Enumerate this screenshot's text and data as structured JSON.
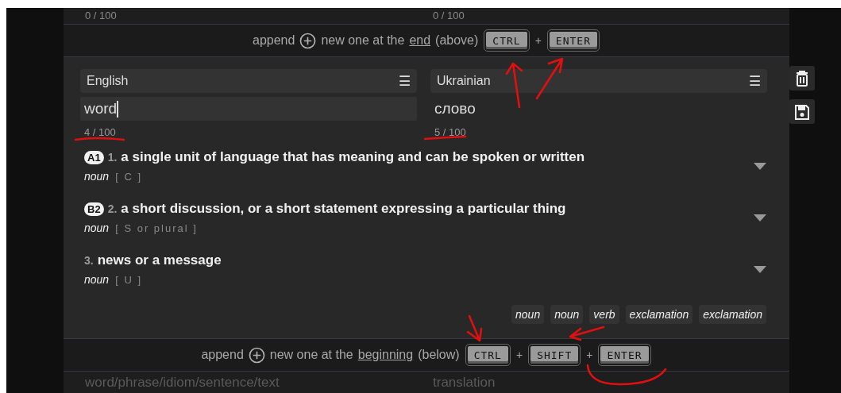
{
  "previous_entry": {
    "counters": [
      "0 / 100",
      "0 / 100"
    ]
  },
  "append_end": {
    "prefix": "append",
    "middle": "new one at the",
    "link": "end",
    "suffix": "(above)",
    "keys": [
      "CTRL",
      "ENTER"
    ],
    "separators": [
      "+"
    ]
  },
  "entry": {
    "languages": [
      {
        "label": "English",
        "menu": "☰"
      },
      {
        "label": "Ukrainian",
        "menu": "☰"
      }
    ],
    "fields": [
      {
        "value": "word",
        "focused": true,
        "counter": "4 / 100"
      },
      {
        "value": "слово",
        "focused": false,
        "counter": "5 / 100"
      }
    ],
    "definitions": [
      {
        "level": "A1",
        "number": "1.",
        "text": "a single unit of language that has meaning and can be spoken or written",
        "pos": "noun",
        "grammar": "[ C ]"
      },
      {
        "level": "B2",
        "number": "2.",
        "text": "a short discussion, or a short statement expressing a particular thing",
        "pos": "noun",
        "grammar": "[ S or plural ]"
      },
      {
        "number": "3.",
        "text": "news or a message",
        "pos": "noun",
        "grammar": "[ U ]"
      }
    ],
    "tags": [
      "noun",
      "noun",
      "verb",
      "exclamation",
      "exclamation"
    ]
  },
  "append_beginning": {
    "prefix": "append",
    "middle": "new one at the",
    "link": "beginning",
    "suffix": "(below)",
    "keys": [
      "CTRL",
      "SHIFT",
      "ENTER"
    ],
    "separators": [
      "+",
      "+"
    ]
  },
  "next_entry": {
    "placeholders": [
      "word/phrase/idiom/sentence/text",
      "translation"
    ]
  }
}
